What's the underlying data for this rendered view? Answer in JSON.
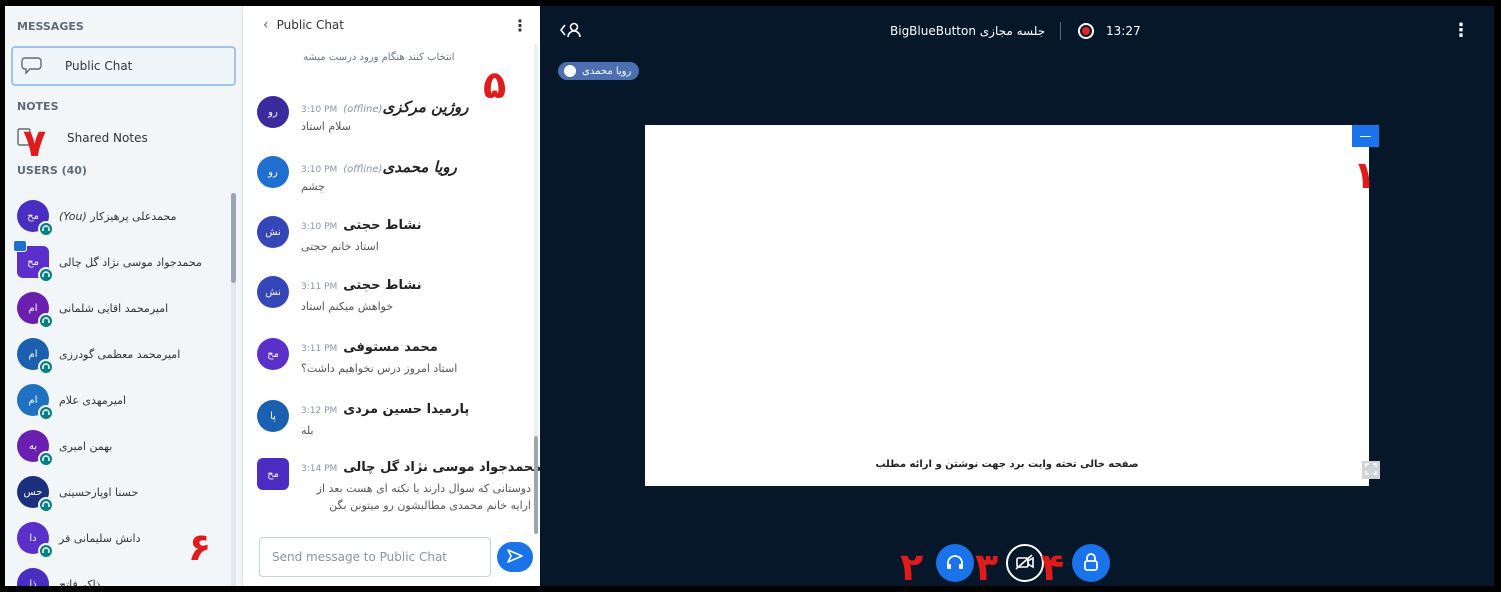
{
  "sidebar": {
    "messages_title": "MESSAGES",
    "public_chat_label": "Public Chat",
    "notes_title": "NOTES",
    "shared_notes_label": "Shared Notes",
    "users_title": "USERS (40)",
    "users": [
      {
        "initials": "مح",
        "name": "محمدعلی پرهیزکار",
        "you": "(You)",
        "color": "#4a2ec2"
      },
      {
        "initials": "مح",
        "name": "محمدجواد موسی نژاد گل چالی",
        "you": "",
        "color": "#5b2fc9"
      },
      {
        "initials": "ام",
        "name": "امیرمحمد اقایی شلمانی",
        "you": "",
        "color": "#6a1fb0"
      },
      {
        "initials": "ام",
        "name": "امیرمحمد معظمی گودرزی",
        "you": "",
        "color": "#1b5fb0"
      },
      {
        "initials": "ام",
        "name": "امیرمهدی علام",
        "you": "",
        "color": "#1f72c2"
      },
      {
        "initials": "به",
        "name": "بهمن امیری",
        "you": "",
        "color": "#6a1fb0"
      },
      {
        "initials": "حس",
        "name": "حسنا اوپارحسینی",
        "you": "",
        "color": "#1b2f7e"
      },
      {
        "initials": "دا",
        "name": "دانش سلیمانی فر",
        "you": "",
        "color": "#5b2fc9"
      },
      {
        "initials": "ذا",
        "name": "ذاکر فاتح",
        "you": "",
        "color": "#4a2ec2"
      }
    ]
  },
  "chat": {
    "title": "Public Chat",
    "top_cut_text": "انتخاب کنند هنگام ورود درست میشه",
    "messages": [
      {
        "initials": "رو",
        "time": "3:10 PM",
        "offline": "(offline)",
        "author": "روژین مرکزی",
        "text": "سلام استاد",
        "color": "#3b2a9e"
      },
      {
        "initials": "رو",
        "time": "3:10 PM",
        "offline": "(offline)",
        "author": "رویا محمدی",
        "text": "چشم",
        "color": "#1f6fd0"
      },
      {
        "initials": "نش",
        "time": "3:10 PM",
        "offline": "",
        "author": "نشاط حجتی",
        "text": "استاد خانم حجتی",
        "color": "#3446b8"
      },
      {
        "initials": "نش",
        "time": "3:11 PM",
        "offline": "",
        "author": "نشاط حجتی",
        "text": "خواهش میکنم استاد",
        "color": "#3446b8"
      },
      {
        "initials": "مح",
        "time": "3:11 PM",
        "offline": "",
        "author": "محمد مستوفی",
        "text": "استاد امروز درس نخواهیم داشت؟",
        "color": "#5b2fc9"
      },
      {
        "initials": "پا",
        "time": "3:12 PM",
        "offline": "",
        "author": "پارمیدا حسین مردی",
        "text": "بله",
        "color": "#1b5fb0"
      },
      {
        "initials": "مح",
        "time": "3:14 PM",
        "offline": "",
        "author": "محمدجواد موسی نژاد گل چالی",
        "text": "دوستانی که سوال دارند یا نکته ای هست بعد از ارایه خانم محمدی مطالبشون رو میتونن بگن",
        "color": "#4a2ec2"
      }
    ],
    "input_placeholder": "Send message to Public Chat"
  },
  "main": {
    "title": "BigBlueButton جلسه مجازی",
    "timer": "13:27",
    "talker": "رویا محمدی",
    "whiteboard_caption": "صفحه خالی تخته وایت برد جهت نوشتن و ارائه مطلب",
    "minimize_label": "—"
  },
  "annotations": [
    "۱",
    "۲",
    "۳",
    "۴",
    "۵",
    "۶",
    "۷"
  ],
  "colors": {
    "accent": "#1a73e8",
    "mic_badge": "#008081",
    "record": "#e02424",
    "background_dark": "#06172a",
    "annotation": "#e01b1b"
  }
}
